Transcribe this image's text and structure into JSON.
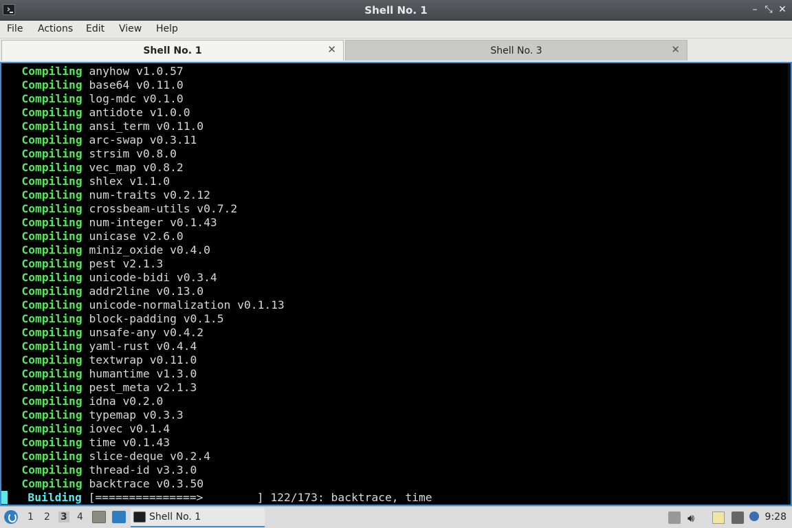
{
  "window": {
    "title": "Shell No. 1",
    "controls": [
      "minimize",
      "maximize",
      "close"
    ]
  },
  "menu": [
    "File",
    "Actions",
    "Edit",
    "View",
    "Help"
  ],
  "tabs": [
    {
      "label": "Shell No. 1",
      "active": true
    },
    {
      "label": "Shell No. 3",
      "active": false
    }
  ],
  "terminal": {
    "lines": [
      {
        "status": "Compiling",
        "text": "anyhow v1.0.57"
      },
      {
        "status": "Compiling",
        "text": "base64 v0.11.0"
      },
      {
        "status": "Compiling",
        "text": "log-mdc v0.1.0"
      },
      {
        "status": "Compiling",
        "text": "antidote v1.0.0"
      },
      {
        "status": "Compiling",
        "text": "ansi_term v0.11.0"
      },
      {
        "status": "Compiling",
        "text": "arc-swap v0.3.11"
      },
      {
        "status": "Compiling",
        "text": "strsim v0.8.0"
      },
      {
        "status": "Compiling",
        "text": "vec_map v0.8.2"
      },
      {
        "status": "Compiling",
        "text": "shlex v1.1.0"
      },
      {
        "status": "Compiling",
        "text": "num-traits v0.2.12"
      },
      {
        "status": "Compiling",
        "text": "crossbeam-utils v0.7.2"
      },
      {
        "status": "Compiling",
        "text": "num-integer v0.1.43"
      },
      {
        "status": "Compiling",
        "text": "unicase v2.6.0"
      },
      {
        "status": "Compiling",
        "text": "miniz_oxide v0.4.0"
      },
      {
        "status": "Compiling",
        "text": "pest v2.1.3"
      },
      {
        "status": "Compiling",
        "text": "unicode-bidi v0.3.4"
      },
      {
        "status": "Compiling",
        "text": "addr2line v0.13.0"
      },
      {
        "status": "Compiling",
        "text": "unicode-normalization v0.1.13"
      },
      {
        "status": "Compiling",
        "text": "block-padding v0.1.5"
      },
      {
        "status": "Compiling",
        "text": "unsafe-any v0.4.2"
      },
      {
        "status": "Compiling",
        "text": "yaml-rust v0.4.4"
      },
      {
        "status": "Compiling",
        "text": "textwrap v0.11.0"
      },
      {
        "status": "Compiling",
        "text": "humantime v1.3.0"
      },
      {
        "status": "Compiling",
        "text": "pest_meta v2.1.3"
      },
      {
        "status": "Compiling",
        "text": "idna v0.2.0"
      },
      {
        "status": "Compiling",
        "text": "typemap v0.3.3"
      },
      {
        "status": "Compiling",
        "text": "iovec v0.1.4"
      },
      {
        "status": "Compiling",
        "text": "time v0.1.43"
      },
      {
        "status": "Compiling",
        "text": "slice-deque v0.2.4"
      },
      {
        "status": "Compiling",
        "text": "thread-id v3.3.0"
      },
      {
        "status": "Compiling",
        "text": "backtrace v0.3.50"
      }
    ],
    "building": {
      "status": "Building",
      "progress_bar": "[===============>        ]",
      "progress_text": "122/173: backtrace, time"
    }
  },
  "taskbar": {
    "workspaces": [
      "1",
      "2",
      "3",
      "4"
    ],
    "active_workspace": "3",
    "task": {
      "label": "Shell No. 1"
    },
    "clock": "9:28",
    "accent": "#3c8fd6"
  }
}
